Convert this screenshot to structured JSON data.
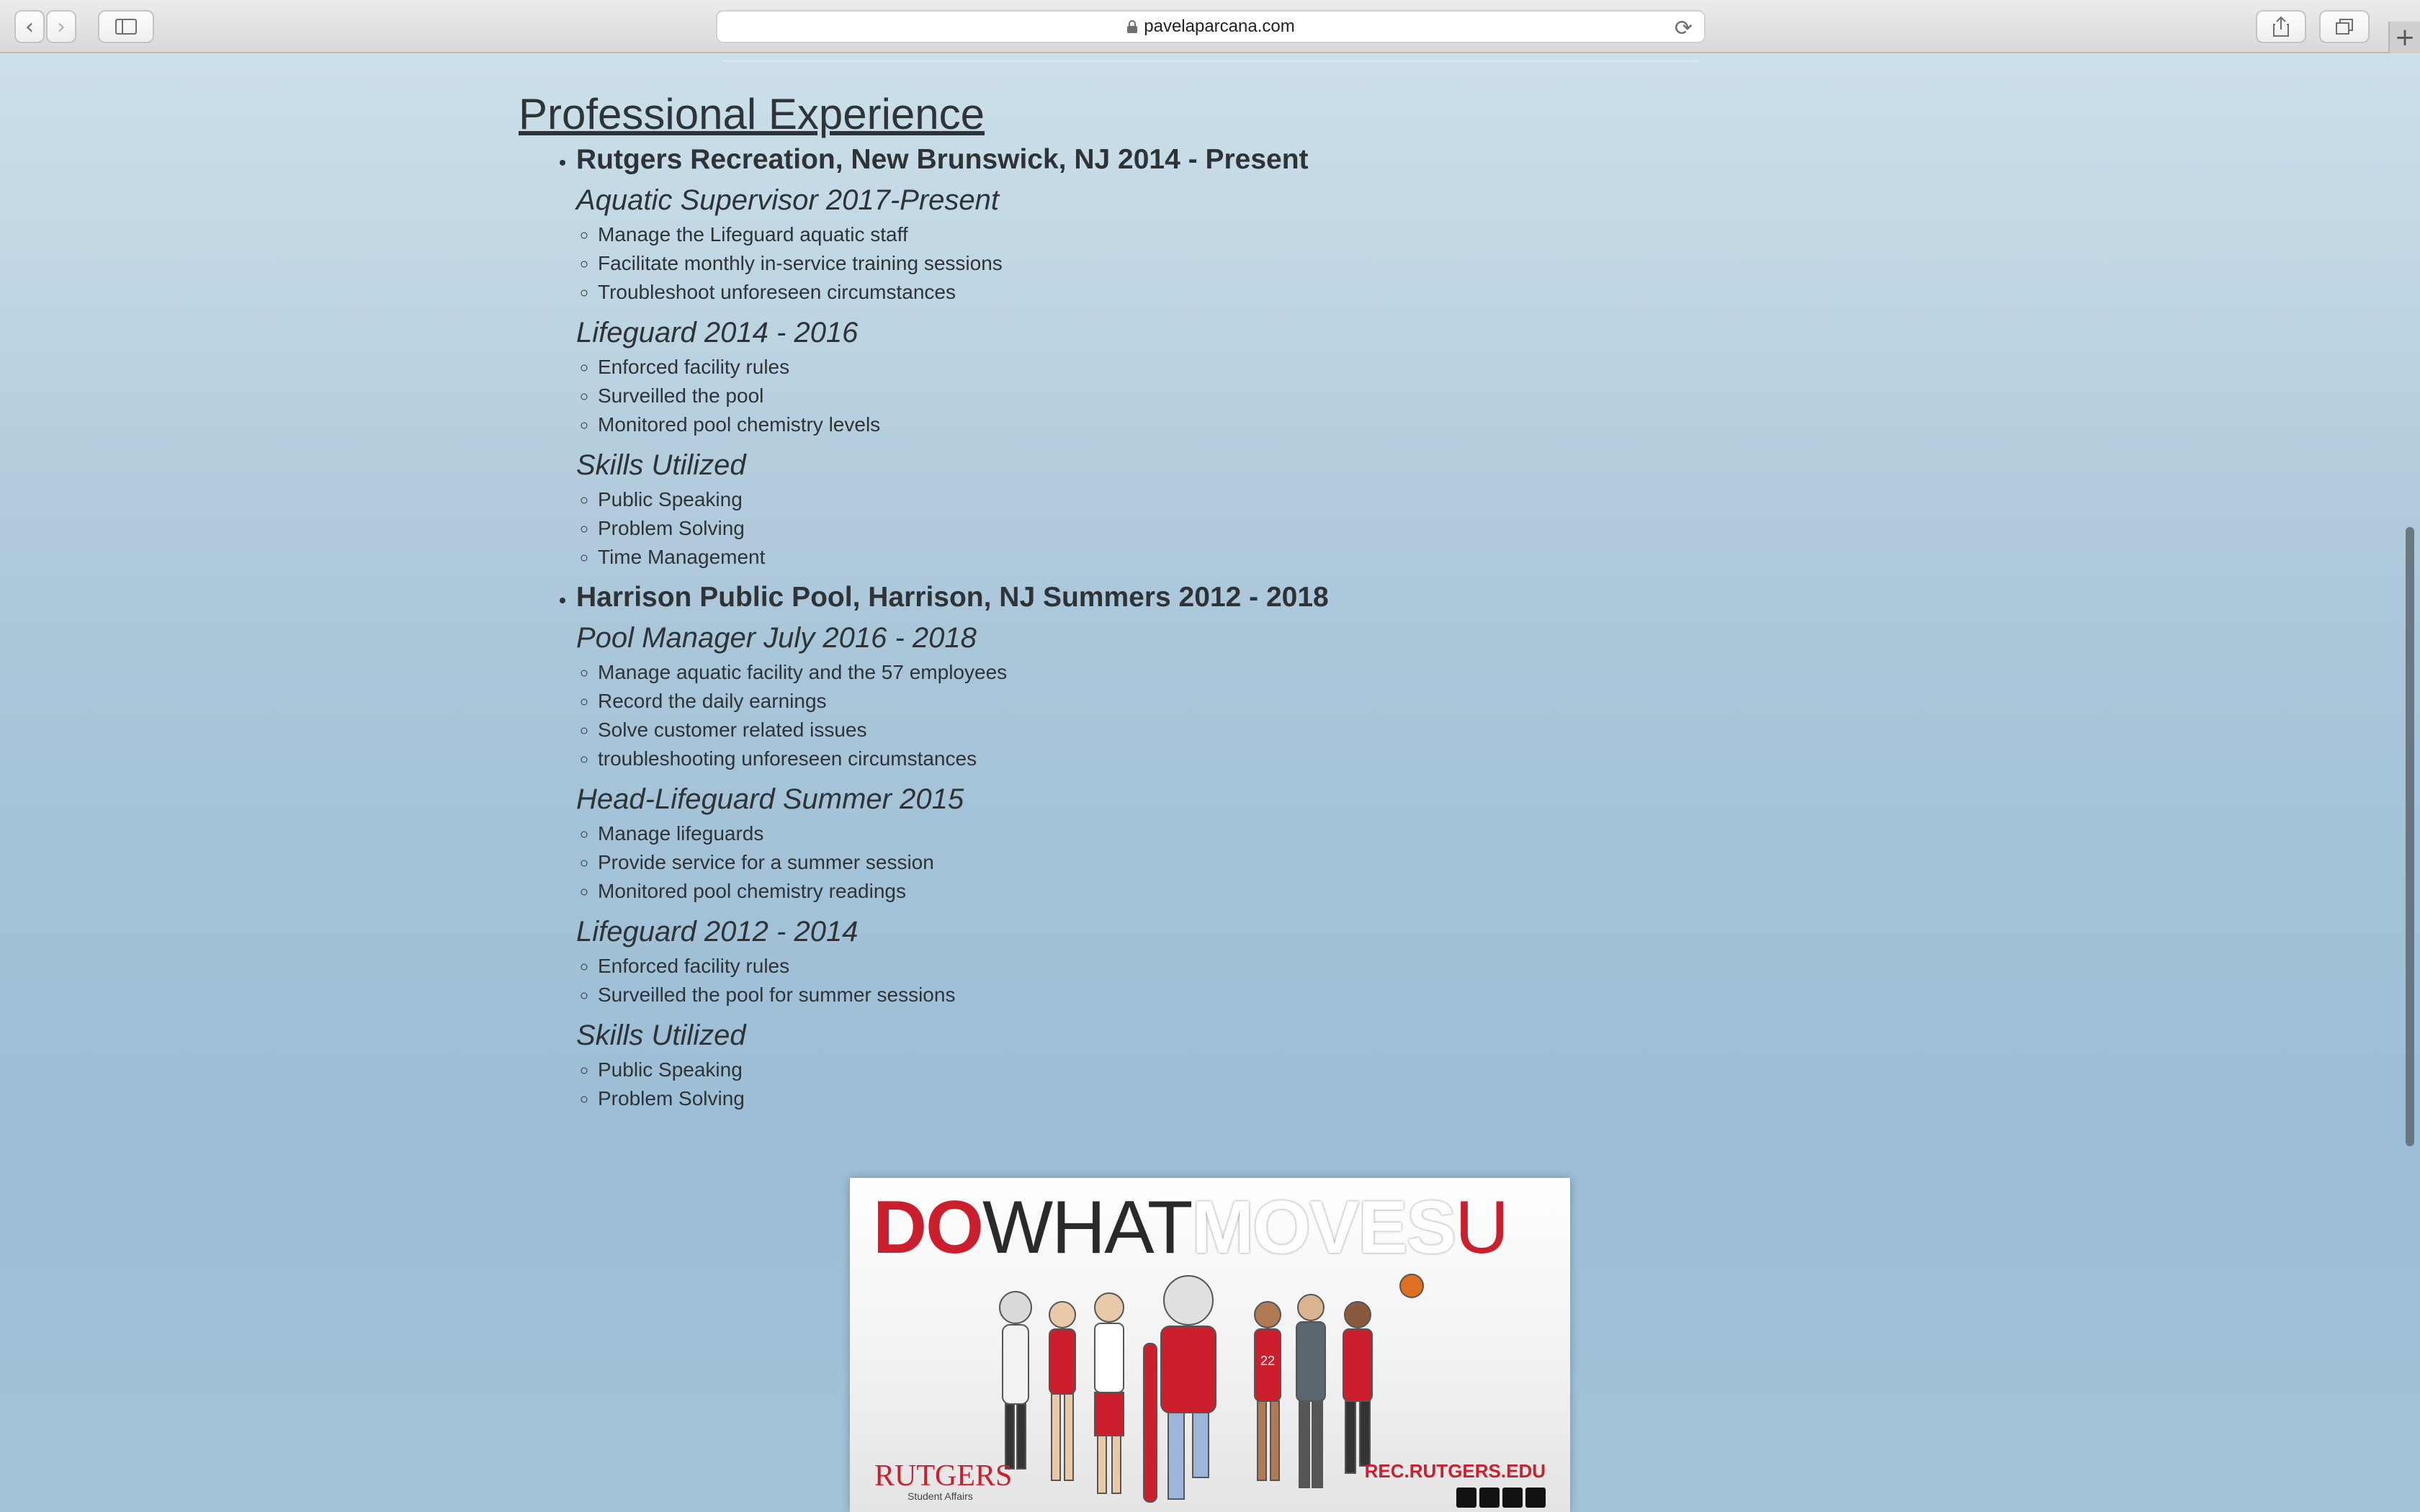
{
  "browser": {
    "url": "pavelaparcana.com",
    "back_icon": "‹",
    "forward_icon": "›",
    "new_tab": "+"
  },
  "section": {
    "heading": "Professional Experience",
    "jobs": [
      {
        "title": "Rutgers Recreation, New Brunswick, NJ 2014 - Present",
        "roles": [
          {
            "title": "Aquatic Supervisor 2017-Present",
            "items": [
              "Manage the Lifeguard aquatic staff",
              "Facilitate monthly in-service training sessions",
              "Troubleshoot unforeseen circumstances"
            ]
          },
          {
            "title": "Lifeguard 2014 - 2016",
            "items": [
              "Enforced facility rules",
              "Surveilled the pool",
              "Monitored pool chemistry levels"
            ]
          },
          {
            "title": "Skills Utilized",
            "items": [
              "Public Speaking",
              "Problem Solving",
              "Time Management"
            ]
          }
        ]
      },
      {
        "title": "Harrison Public Pool, Harrison, NJ Summers 2012 - 2018",
        "roles": [
          {
            "title": "Pool Manager July 2016 - 2018",
            "items": [
              "Manage aquatic facility and the 57 employees",
              "Record the daily earnings",
              "Solve customer related issues",
              "troubleshooting unforeseen circumstances"
            ]
          },
          {
            "title": "Head-Lifeguard Summer 2015",
            "items": [
              "Manage lifeguards",
              "Provide service for a summer session",
              "Monitored pool chemistry readings"
            ]
          },
          {
            "title": "Lifeguard 2012 - 2014",
            "items": [
              "Enforced facility rules",
              "Surveilled the pool for summer sessions"
            ]
          },
          {
            "title": "Skills Utilized",
            "items": [
              "Public Speaking",
              "Problem Solving"
            ]
          }
        ]
      }
    ]
  },
  "banner": {
    "headline_do": "DO",
    "headline_what": "WHAT",
    "headline_moves": "MOVES",
    "headline_u": "U",
    "brand": "RUTGERS",
    "brand_sub": "Student Affairs",
    "site": "REC.RUTGERS.EDU",
    "figure_number": "22"
  }
}
